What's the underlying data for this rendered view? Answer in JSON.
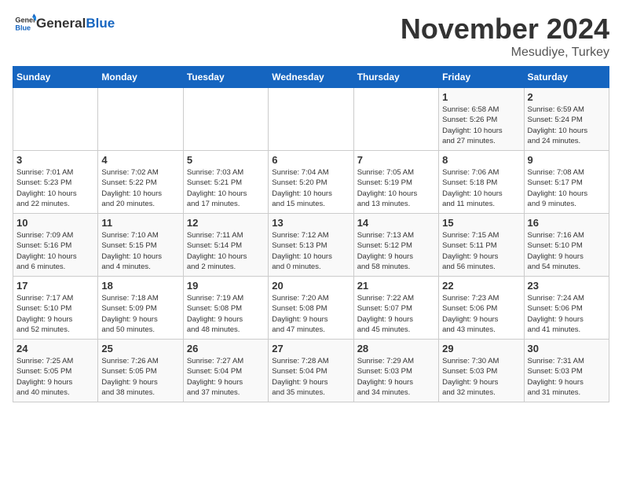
{
  "header": {
    "logo_general": "General",
    "logo_blue": "Blue",
    "month_title": "November 2024",
    "location": "Mesudiye, Turkey"
  },
  "days_of_week": [
    "Sunday",
    "Monday",
    "Tuesday",
    "Wednesday",
    "Thursday",
    "Friday",
    "Saturday"
  ],
  "weeks": [
    [
      {
        "day": "",
        "info": ""
      },
      {
        "day": "",
        "info": ""
      },
      {
        "day": "",
        "info": ""
      },
      {
        "day": "",
        "info": ""
      },
      {
        "day": "",
        "info": ""
      },
      {
        "day": "1",
        "info": "Sunrise: 6:58 AM\nSunset: 5:26 PM\nDaylight: 10 hours\nand 27 minutes."
      },
      {
        "day": "2",
        "info": "Sunrise: 6:59 AM\nSunset: 5:24 PM\nDaylight: 10 hours\nand 24 minutes."
      }
    ],
    [
      {
        "day": "3",
        "info": "Sunrise: 7:01 AM\nSunset: 5:23 PM\nDaylight: 10 hours\nand 22 minutes."
      },
      {
        "day": "4",
        "info": "Sunrise: 7:02 AM\nSunset: 5:22 PM\nDaylight: 10 hours\nand 20 minutes."
      },
      {
        "day": "5",
        "info": "Sunrise: 7:03 AM\nSunset: 5:21 PM\nDaylight: 10 hours\nand 17 minutes."
      },
      {
        "day": "6",
        "info": "Sunrise: 7:04 AM\nSunset: 5:20 PM\nDaylight: 10 hours\nand 15 minutes."
      },
      {
        "day": "7",
        "info": "Sunrise: 7:05 AM\nSunset: 5:19 PM\nDaylight: 10 hours\nand 13 minutes."
      },
      {
        "day": "8",
        "info": "Sunrise: 7:06 AM\nSunset: 5:18 PM\nDaylight: 10 hours\nand 11 minutes."
      },
      {
        "day": "9",
        "info": "Sunrise: 7:08 AM\nSunset: 5:17 PM\nDaylight: 10 hours\nand 9 minutes."
      }
    ],
    [
      {
        "day": "10",
        "info": "Sunrise: 7:09 AM\nSunset: 5:16 PM\nDaylight: 10 hours\nand 6 minutes."
      },
      {
        "day": "11",
        "info": "Sunrise: 7:10 AM\nSunset: 5:15 PM\nDaylight: 10 hours\nand 4 minutes."
      },
      {
        "day": "12",
        "info": "Sunrise: 7:11 AM\nSunset: 5:14 PM\nDaylight: 10 hours\nand 2 minutes."
      },
      {
        "day": "13",
        "info": "Sunrise: 7:12 AM\nSunset: 5:13 PM\nDaylight: 10 hours\nand 0 minutes."
      },
      {
        "day": "14",
        "info": "Sunrise: 7:13 AM\nSunset: 5:12 PM\nDaylight: 9 hours\nand 58 minutes."
      },
      {
        "day": "15",
        "info": "Sunrise: 7:15 AM\nSunset: 5:11 PM\nDaylight: 9 hours\nand 56 minutes."
      },
      {
        "day": "16",
        "info": "Sunrise: 7:16 AM\nSunset: 5:10 PM\nDaylight: 9 hours\nand 54 minutes."
      }
    ],
    [
      {
        "day": "17",
        "info": "Sunrise: 7:17 AM\nSunset: 5:10 PM\nDaylight: 9 hours\nand 52 minutes."
      },
      {
        "day": "18",
        "info": "Sunrise: 7:18 AM\nSunset: 5:09 PM\nDaylight: 9 hours\nand 50 minutes."
      },
      {
        "day": "19",
        "info": "Sunrise: 7:19 AM\nSunset: 5:08 PM\nDaylight: 9 hours\nand 48 minutes."
      },
      {
        "day": "20",
        "info": "Sunrise: 7:20 AM\nSunset: 5:08 PM\nDaylight: 9 hours\nand 47 minutes."
      },
      {
        "day": "21",
        "info": "Sunrise: 7:22 AM\nSunset: 5:07 PM\nDaylight: 9 hours\nand 45 minutes."
      },
      {
        "day": "22",
        "info": "Sunrise: 7:23 AM\nSunset: 5:06 PM\nDaylight: 9 hours\nand 43 minutes."
      },
      {
        "day": "23",
        "info": "Sunrise: 7:24 AM\nSunset: 5:06 PM\nDaylight: 9 hours\nand 41 minutes."
      }
    ],
    [
      {
        "day": "24",
        "info": "Sunrise: 7:25 AM\nSunset: 5:05 PM\nDaylight: 9 hours\nand 40 minutes."
      },
      {
        "day": "25",
        "info": "Sunrise: 7:26 AM\nSunset: 5:05 PM\nDaylight: 9 hours\nand 38 minutes."
      },
      {
        "day": "26",
        "info": "Sunrise: 7:27 AM\nSunset: 5:04 PM\nDaylight: 9 hours\nand 37 minutes."
      },
      {
        "day": "27",
        "info": "Sunrise: 7:28 AM\nSunset: 5:04 PM\nDaylight: 9 hours\nand 35 minutes."
      },
      {
        "day": "28",
        "info": "Sunrise: 7:29 AM\nSunset: 5:03 PM\nDaylight: 9 hours\nand 34 minutes."
      },
      {
        "day": "29",
        "info": "Sunrise: 7:30 AM\nSunset: 5:03 PM\nDaylight: 9 hours\nand 32 minutes."
      },
      {
        "day": "30",
        "info": "Sunrise: 7:31 AM\nSunset: 5:03 PM\nDaylight: 9 hours\nand 31 minutes."
      }
    ]
  ]
}
